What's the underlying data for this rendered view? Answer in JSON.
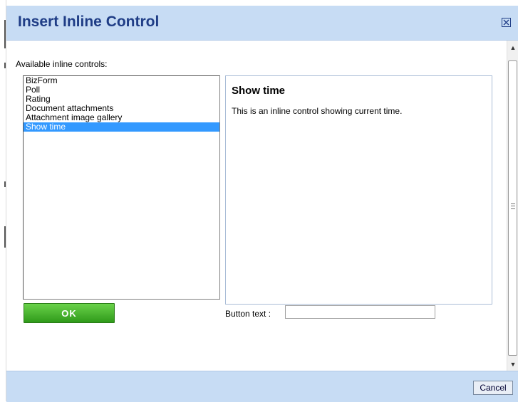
{
  "dialog": {
    "title": "Insert Inline Control",
    "close_icon": "close-x-box-icon",
    "available_label": "Available inline controls:",
    "controls": [
      {
        "label": "BizForm",
        "selected": false
      },
      {
        "label": "Poll",
        "selected": false
      },
      {
        "label": "Rating",
        "selected": false
      },
      {
        "label": "Document attachments",
        "selected": false
      },
      {
        "label": "Attachment image gallery",
        "selected": false
      },
      {
        "label": "Show time",
        "selected": true
      }
    ],
    "preview": {
      "title": "Show time",
      "description": "This is an inline control showing current time."
    },
    "ok_label": "OK",
    "button_text_label": "Button text :",
    "button_text_value": "",
    "cancel_label": "Cancel"
  },
  "colors": {
    "titlebar": "#c7dcf4",
    "title_text": "#1f3d86",
    "selection": "#3399ff",
    "ok_button": "#3aaa24"
  }
}
